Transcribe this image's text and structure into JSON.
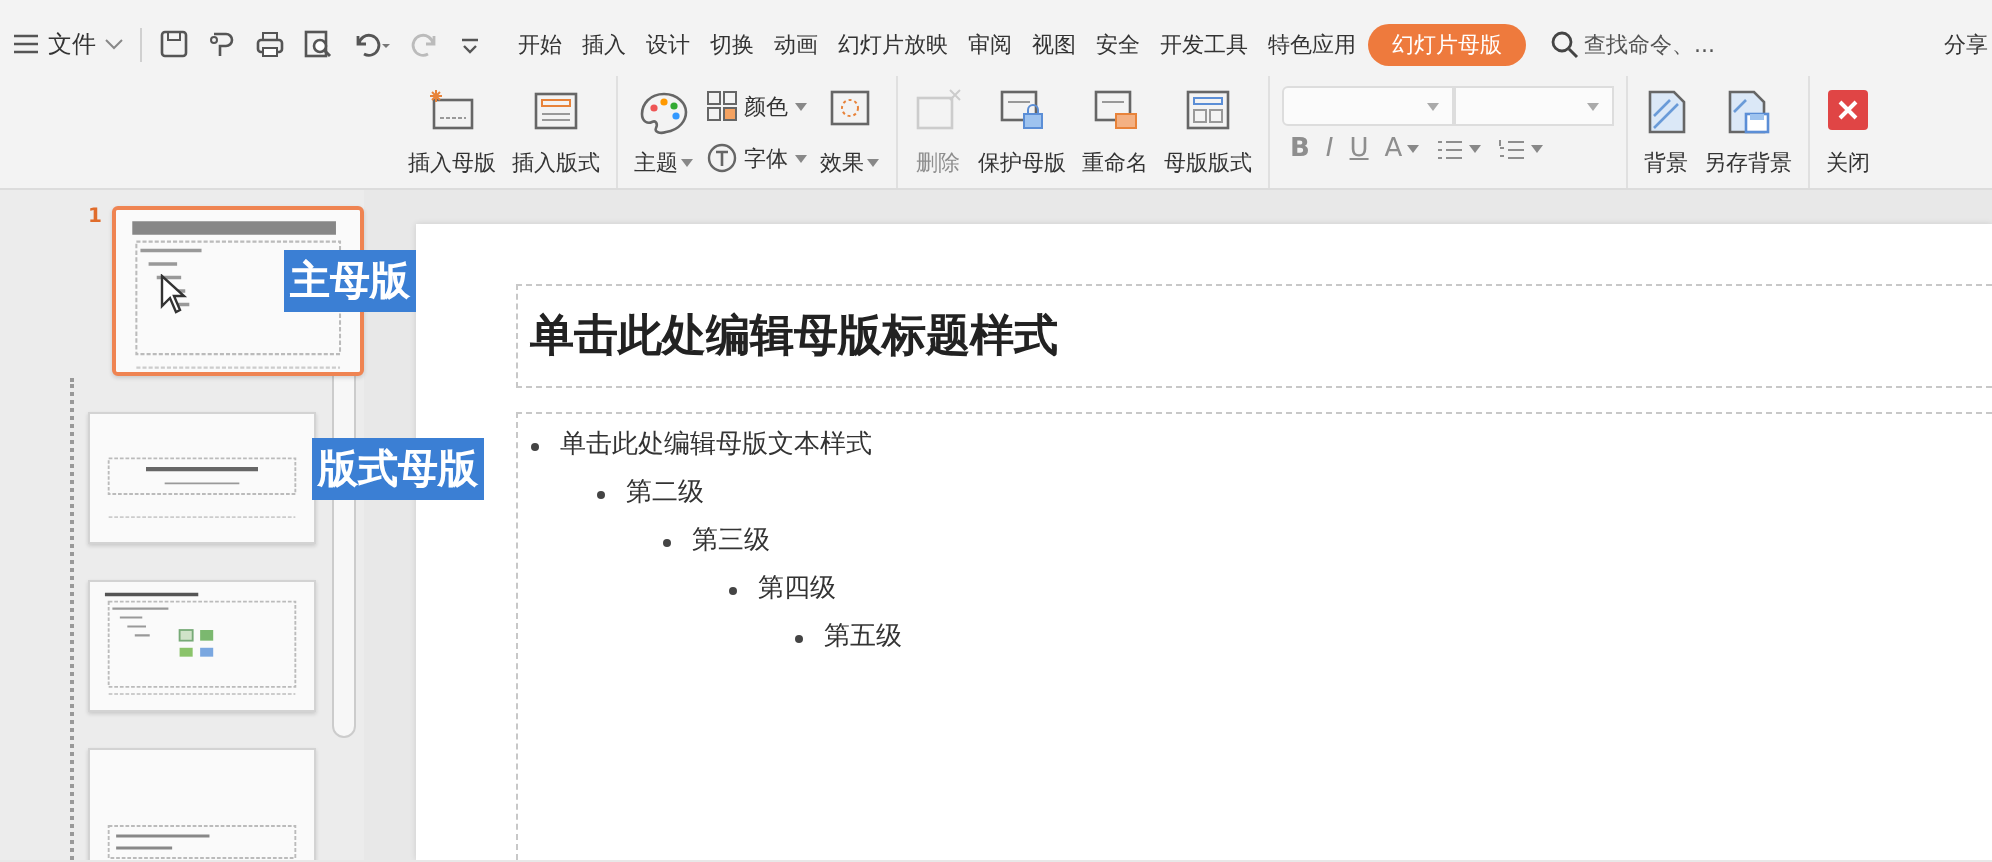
{
  "menu": {
    "label": "文件"
  },
  "tabs": [
    {
      "label": "开始",
      "selected": false
    },
    {
      "label": "插入",
      "selected": false
    },
    {
      "label": "设计",
      "selected": false
    },
    {
      "label": "切换",
      "selected": false
    },
    {
      "label": "动画",
      "selected": false
    },
    {
      "label": "幻灯片放映",
      "selected": false
    },
    {
      "label": "审阅",
      "selected": false
    },
    {
      "label": "视图",
      "selected": false
    },
    {
      "label": "安全",
      "selected": false
    },
    {
      "label": "开发工具",
      "selected": false
    },
    {
      "label": "特色应用",
      "selected": false
    },
    {
      "label": "幻灯片母版",
      "selected": true
    }
  ],
  "search": {
    "placeholder": "查找命令、..."
  },
  "share": {
    "label": "分享"
  },
  "ribbon": {
    "groups": [
      {
        "kind": "buttons",
        "items": [
          {
            "kind": "large",
            "label": "插入母版",
            "dropdown": false,
            "disabled": false
          },
          {
            "kind": "large",
            "label": "插入版式",
            "dropdown": false,
            "disabled": false
          }
        ]
      },
      {
        "kind": "buttons",
        "items": [
          {
            "kind": "large",
            "label": "主题",
            "dropdown": true,
            "disabled": false
          },
          {
            "kind": "small",
            "label": "颜色",
            "dropdown": true,
            "disabled": false
          },
          {
            "kind": "small",
            "label": "字体",
            "dropdown": true,
            "disabled": false
          },
          {
            "kind": "large",
            "label": "效果",
            "dropdown": true,
            "disabled": false
          }
        ]
      },
      {
        "kind": "buttons",
        "items": [
          {
            "kind": "large",
            "label": "删除",
            "dropdown": false,
            "disabled": true
          },
          {
            "kind": "large",
            "label": "保护母版",
            "dropdown": false,
            "disabled": false
          },
          {
            "kind": "large",
            "label": "重命名",
            "dropdown": false,
            "disabled": false
          },
          {
            "kind": "large",
            "label": "母版版式",
            "dropdown": false,
            "disabled": false
          }
        ]
      },
      {
        "kind": "format",
        "items": [
          {
            "kind": "text",
            "label": "B",
            "dropdown": false,
            "disabled": true
          },
          {
            "kind": "text",
            "label": "I",
            "dropdown": false,
            "disabled": true
          },
          {
            "kind": "text",
            "label": "U",
            "dropdown": false,
            "disabled": true
          },
          {
            "kind": "text",
            "label": "A",
            "dropdown": true,
            "disabled": true
          },
          {
            "kind": "bullets",
            "dropdown": true,
            "disabled": true
          },
          {
            "kind": "numbering",
            "dropdown": true,
            "disabled": true
          }
        ]
      },
      {
        "kind": "buttons",
        "items": [
          {
            "kind": "large",
            "label": "背景",
            "dropdown": false,
            "disabled": false
          },
          {
            "kind": "large",
            "label": "另存背景",
            "dropdown": false,
            "disabled": false
          }
        ]
      },
      {
        "kind": "buttons",
        "items": [
          {
            "kind": "large",
            "label": "关闭",
            "dropdown": false,
            "disabled": false
          }
        ]
      }
    ]
  },
  "thumbnails": [
    {
      "number": "1",
      "kind": "master",
      "selected": true
    },
    {
      "kind": "title",
      "selected": false
    },
    {
      "kind": "content",
      "selected": false
    },
    {
      "kind": "section",
      "selected": false
    }
  ],
  "callouts": [
    {
      "text": "主母版"
    },
    {
      "text": "版式母版"
    }
  ],
  "slide": {
    "title": "单击此处编辑母版标题样式",
    "bullets": [
      {
        "text": "单击此处编辑母版文本样式",
        "children": [
          {
            "text": "第二级",
            "children": [
              {
                "text": "第三级",
                "children": [
                  {
                    "text": "第四级",
                    "children": [
                      {
                        "text": "第五级"
                      }
                    ]
                  }
                ]
              }
            ]
          }
        ]
      }
    ]
  }
}
